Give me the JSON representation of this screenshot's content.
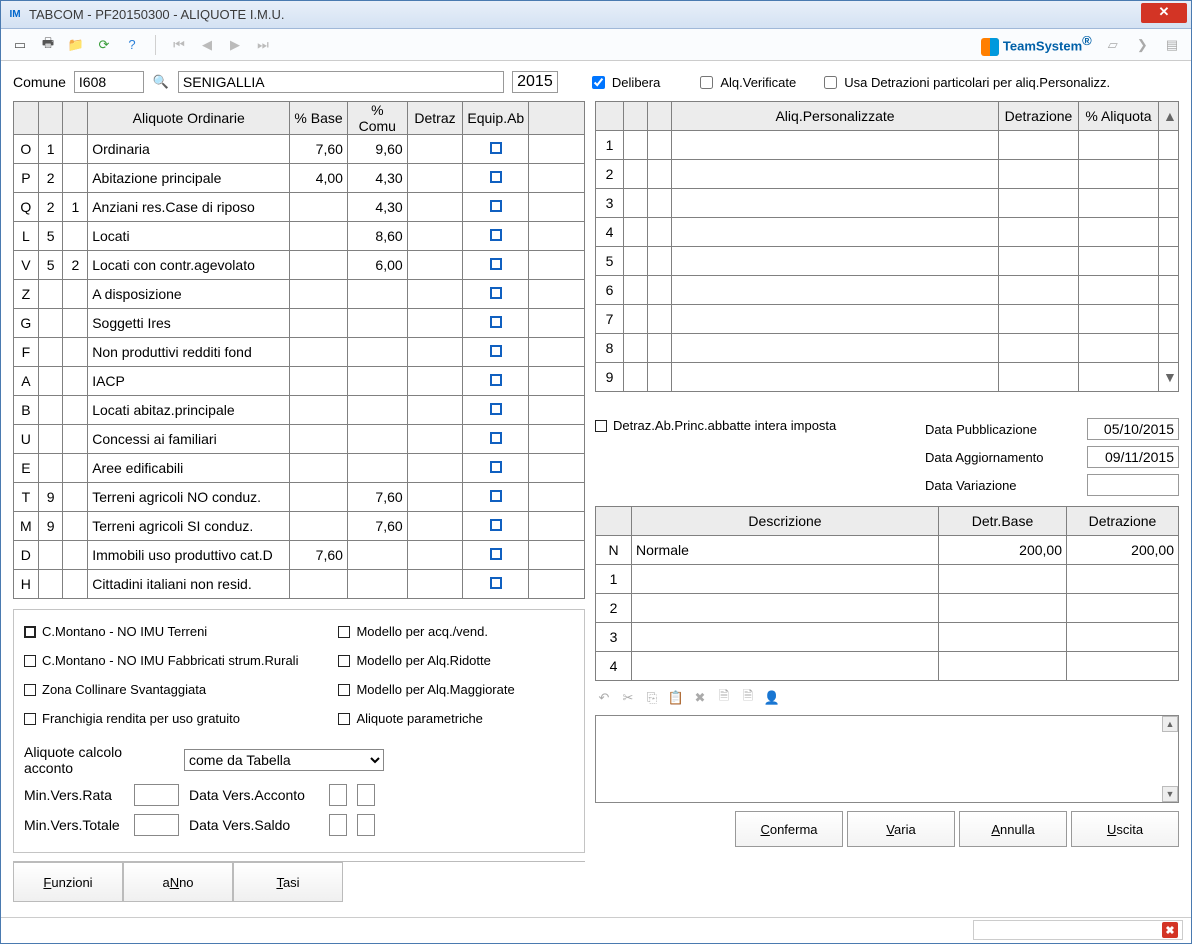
{
  "window": {
    "title": "TABCOM  - PF20150300 -  ALIQUOTE I.M.U."
  },
  "comune": {
    "label": "Comune",
    "code": "I608",
    "name": "SENIGALLIA",
    "year": "2015"
  },
  "top_checks": {
    "delibera": "Delibera",
    "alq_verificate": "Alq.Verificate",
    "usa_detraz": "Usa Detrazioni particolari per aliq.Personalizz."
  },
  "left_grid": {
    "headers": [
      "",
      "",
      "",
      "Aliquote Ordinarie",
      "% Base",
      "% Comu",
      "Detraz",
      "Equip.Ab",
      ""
    ],
    "rows": [
      {
        "c1": "O",
        "c2": "1",
        "c3": "",
        "desc": "Ordinaria",
        "base": "7,60",
        "comu": "9,60"
      },
      {
        "c1": "P",
        "c2": "2",
        "c3": "",
        "desc": "Abitazione principale",
        "base": "4,00",
        "comu": "4,30"
      },
      {
        "c1": "Q",
        "c2": "2",
        "c3": "1",
        "desc": "Anziani res.Case di riposo",
        "base": "",
        "comu": "4,30"
      },
      {
        "c1": "L",
        "c2": "5",
        "c3": "",
        "desc": "Locati",
        "base": "",
        "comu": "8,60"
      },
      {
        "c1": "V",
        "c2": "5",
        "c3": "2",
        "desc": "Locati con contr.agevolato",
        "base": "",
        "comu": "6,00"
      },
      {
        "c1": "Z",
        "c2": "",
        "c3": "",
        "desc": "A disposizione",
        "base": "",
        "comu": ""
      },
      {
        "c1": "G",
        "c2": "",
        "c3": "",
        "desc": "Soggetti Ires",
        "base": "",
        "comu": ""
      },
      {
        "c1": "F",
        "c2": "",
        "c3": "",
        "desc": "Non produttivi redditi fond",
        "base": "",
        "comu": ""
      },
      {
        "c1": "A",
        "c2": "",
        "c3": "",
        "desc": "IACP",
        "base": "",
        "comu": ""
      },
      {
        "c1": "B",
        "c2": "",
        "c3": "",
        "desc": "Locati abitaz.principale",
        "base": "",
        "comu": ""
      },
      {
        "c1": "U",
        "c2": "",
        "c3": "",
        "desc": "Concessi ai familiari",
        "base": "",
        "comu": ""
      },
      {
        "c1": "E",
        "c2": "",
        "c3": "",
        "desc": "Aree edificabili",
        "base": "",
        "comu": ""
      },
      {
        "c1": "T",
        "c2": "9",
        "c3": "",
        "desc": "Terreni agricoli NO conduz.",
        "base": "",
        "comu": "7,60"
      },
      {
        "c1": "M",
        "c2": "9",
        "c3": "",
        "desc": "Terreni agricoli SI conduz.",
        "base": "",
        "comu": "7,60"
      },
      {
        "c1": "D",
        "c2": "",
        "c3": "",
        "desc": "Immobili uso produttivo cat.D",
        "base": "7,60",
        "comu": ""
      },
      {
        "c1": "H",
        "c2": "",
        "c3": "",
        "desc": "Cittadini italiani non resid.",
        "base": "",
        "comu": ""
      }
    ]
  },
  "right_grid": {
    "headers": [
      "",
      "",
      "",
      "Aliq.Personalizzate",
      "Detrazione",
      "% Aliquota",
      ""
    ],
    "rows": [
      "1",
      "2",
      "3",
      "4",
      "5",
      "6",
      "7",
      "8",
      "9"
    ]
  },
  "dates": {
    "pub_lbl": "Data Pubblicazione",
    "pub_val": "05/10/2015",
    "agg_lbl": "Data Aggiornamento",
    "agg_val": "09/11/2015",
    "var_lbl": "Data Variazione",
    "var_val": ""
  },
  "abbatte": "Detraz.Ab.Princ.abbatte intera imposta",
  "detraz_grid": {
    "headers": [
      "",
      "Descrizione",
      "Detr.Base",
      "Detrazione"
    ],
    "rows": [
      {
        "k": "N",
        "desc": "Normale",
        "base": "200,00",
        "detr": "200,00"
      },
      {
        "k": "1",
        "desc": "",
        "base": "",
        "detr": ""
      },
      {
        "k": "2",
        "desc": "",
        "base": "",
        "detr": ""
      },
      {
        "k": "3",
        "desc": "",
        "base": "",
        "detr": ""
      },
      {
        "k": "4",
        "desc": "",
        "base": "",
        "detr": ""
      }
    ]
  },
  "opts_left": [
    "C.Montano - NO IMU Terreni",
    "C.Montano - NO IMU Fabbricati strum.Rurali",
    "Zona Collinare Svantaggiata",
    "Franchigia rendita per uso gratuito"
  ],
  "opts_right": [
    "Modello per acq./vend.",
    "Modello per Alq.Ridotte",
    "Modello per Alq.Maggiorate",
    "Aliquote parametriche"
  ],
  "acconto": {
    "label": "Aliquote calcolo acconto",
    "value": "come da Tabella"
  },
  "minvers": {
    "rata": "Min.Vers.Rata",
    "totale": "Min.Vers.Totale",
    "dv_acconto": "Data Vers.Acconto",
    "dv_saldo": "Data Vers.Saldo"
  },
  "bottom_left_btns": {
    "funzioni": "Funzioni",
    "anno": "aNno",
    "tasi": "Tasi"
  },
  "bottom_right_btns": {
    "conferma": "Conferma",
    "varia": "Varia",
    "annulla": "Annulla",
    "uscita": "Uscita"
  },
  "logo": "TeamSystem"
}
